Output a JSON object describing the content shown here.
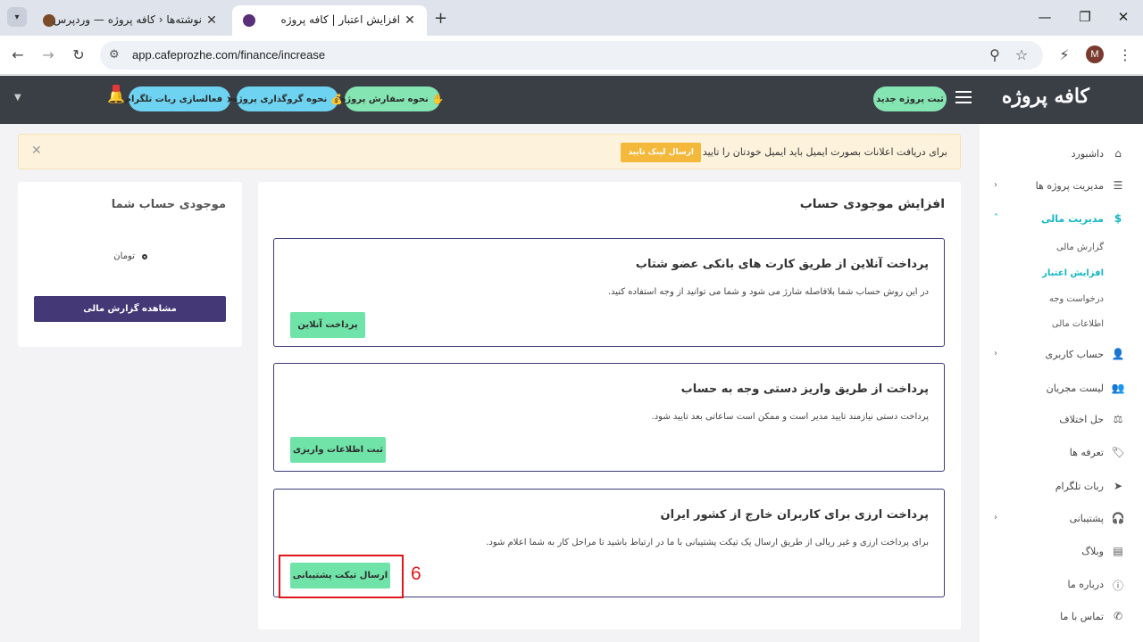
{
  "browser": {
    "tabs": [
      {
        "title": "نوشته‌ها ‹ کافه پروژه — وردپرس",
        "active": false
      },
      {
        "title": "افزایش اعتبار | کافه پروژه",
        "active": true
      }
    ],
    "url": "app.cafeprozhe.com/finance/increase",
    "avatar_letter": "M"
  },
  "header": {
    "logo": "کافه پروژه",
    "new_project": "ثبت پروژه جدید",
    "links": [
      {
        "label": "نحوه سفارش پروژه",
        "icon": "hand-icon"
      },
      {
        "label": "نحوه گروگذاری پروژه",
        "icon": "money-bag-icon"
      },
      {
        "label": "فعالسازی ربات تلگرام",
        "icon": "telegram-icon"
      }
    ]
  },
  "alert": {
    "text": "برای دریافت اعلانات بصورت ایمیل باید ایمیل خودتان را تایید کنید.",
    "button": "ارسال لینک تایید",
    "close": "✕"
  },
  "sidebar": {
    "items": [
      {
        "label": "داشبورد",
        "icon": "home-icon"
      },
      {
        "label": "مدیریت پروژه ها",
        "icon": "list-icon"
      },
      {
        "label": "مدیریت مالی",
        "icon": "dollar-icon"
      },
      {
        "label": "حساب کاربری",
        "icon": "user-icon"
      },
      {
        "label": "لیست مجریان",
        "icon": "users-icon"
      },
      {
        "label": "حل اختلاف",
        "icon": "scale-icon"
      },
      {
        "label": "تعرفه ها",
        "icon": "tag-icon"
      },
      {
        "label": "ربات تلگرام",
        "icon": "send-icon"
      },
      {
        "label": "پشتیبانی",
        "icon": "headset-icon"
      },
      {
        "label": "وبلاگ",
        "icon": "blog-icon"
      },
      {
        "label": "درباره ما",
        "icon": "info-icon"
      },
      {
        "label": "تماس با ما",
        "icon": "phone-icon"
      }
    ],
    "finance_sub": [
      "گزارش مالی",
      "افزایش اعتبار",
      "درخواست وجه",
      "اطلاعات مالی"
    ]
  },
  "main": {
    "title": "افزایش موجودی حساب",
    "options": [
      {
        "title": "پرداخت آنلاین از طریق کارت های بانکی عضو شتاب",
        "desc": "در این روش حساب شما بلافاصله شارژ می شود و شما می توانید از وجه استفاده کنید.",
        "button": "پرداخت آنلاین"
      },
      {
        "title": "پرداخت از طریق واریز دستی وجه به حساب",
        "desc": "پرداخت دستی نیازمند تایید مدیر است و ممکن است ساعاتی بعد تایید شود.",
        "button": "ثبت اطلاعات واریزی"
      },
      {
        "title": "پرداخت ارزی برای کاربران خارج از کشور ایران",
        "desc": "برای پرداخت ارزی و غیر ریالی از طریق ارسال یک تیکت پشتیبانی با ما در ارتباط باشید تا مراحل کار به شما اعلام شود.",
        "button": "ارسال تیکت پشتیبانی"
      }
    ],
    "annotation": "6"
  },
  "balance": {
    "title": "موجودی حساب شما",
    "unit": "تومان",
    "button": "مشاهده گزارش مالی"
  },
  "colors": {
    "header_bg": "#3a3f46",
    "accent": "#13b7c4",
    "primary": "#443876",
    "green_btn": "#6fe3a8",
    "alert_bg": "#fdf3dc",
    "annotation": "#e0161b"
  }
}
